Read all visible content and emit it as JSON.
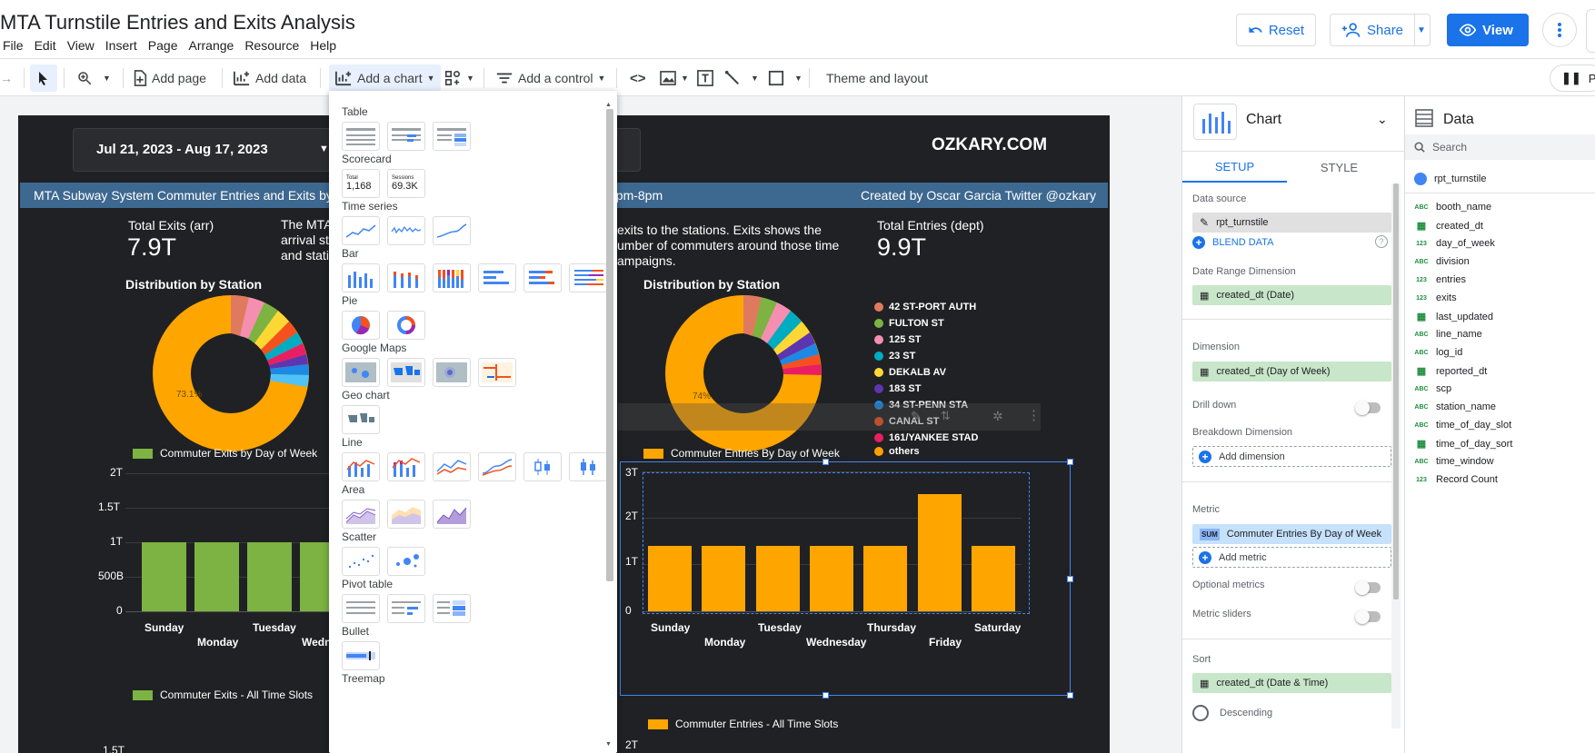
{
  "app": {
    "title": "MTA Turnstile Entries and Exits Analysis",
    "menu": [
      "File",
      "Edit",
      "View",
      "Insert",
      "Page",
      "Arrange",
      "Resource",
      "Help"
    ],
    "buttons": {
      "reset": "Reset",
      "share": "Share",
      "view": "View"
    }
  },
  "toolbar": {
    "add_page": "Add page",
    "add_data": "Add data",
    "add_chart": "Add a chart",
    "add_control": "Add a control",
    "theme_layout": "Theme and layout",
    "page_pill": "Pa"
  },
  "dashboard": {
    "date_range": "Jul 21, 2023 - Aug 17, 2023",
    "brand": "OZKARY.COM",
    "banner_left": "MTA Subway System Commuter Entries and Exits by",
    "banner_mid": "2pm-8pm",
    "banner_right": "Created by Oscar Garcia Twitter @ozkary",
    "left": {
      "kpi_title": "Total Exits (arr)",
      "kpi_value": "7.9T",
      "desc_lines": [
        "The MTA",
        "arrival st",
        "and stati"
      ],
      "dist_title": "Distribution by Station",
      "donut_pct": "73.1%",
      "bar_legend": "Commuter Exits by Day of Week",
      "slots_legend": "Commuter Exits - All Time Slots",
      "y_ticks": [
        "2T",
        "1.5T",
        "1T",
        "500B",
        "0"
      ],
      "bottom_tick": "1.5T",
      "days_top": [
        "Sunday",
        "Tuesday",
        "Wedn"
      ],
      "days_bottom": [
        "Monday"
      ]
    },
    "right": {
      "desc_lines": [
        "exits to the stations. Exits shows the",
        "umber of commuters around those time",
        "ampaigns."
      ],
      "kpi_title": "Total Entries (dept)",
      "kpi_value": "9.9T",
      "dist_title": "Distribution by Station",
      "donut_pct": "74%",
      "stations": [
        {
          "name": "42 ST-PORT AUTH",
          "color": "#e07a5f"
        },
        {
          "name": "FULTON ST",
          "color": "#7cb342"
        },
        {
          "name": "125 ST",
          "color": "#f48fb1"
        },
        {
          "name": "23 ST",
          "color": "#00acc1"
        },
        {
          "name": "DEKALB AV",
          "color": "#fdd835"
        },
        {
          "name": "183 ST",
          "color": "#5e35b1"
        },
        {
          "name": "34 ST-PENN STA",
          "color": "#1e88e5"
        },
        {
          "name": "CANAL ST",
          "color": "#f4511e"
        },
        {
          "name": "161/YANKEE STAD",
          "color": "#e91e63"
        },
        {
          "name": "others",
          "color": "#ffa000"
        }
      ],
      "bar_legend": "Commuter Entries By Day of Week",
      "slots_legend": "Commuter Entries - All Time Slots",
      "y_ticks": [
        "3T",
        "2T",
        "1T",
        "0"
      ],
      "bottom_tick": "2T",
      "days_top": [
        "Sunday",
        "Tuesday",
        "Thursday",
        "Saturday"
      ],
      "days_bottom": [
        "Monday",
        "Wednesday",
        "Friday"
      ]
    },
    "colors": {
      "exits_bar": "#7cb342",
      "entries_bar": "#ffa500",
      "donut_main": "#ffa500",
      "banner": "#3d6890"
    }
  },
  "chart_picker": {
    "sections": [
      "Table",
      "Scorecard",
      "Time series",
      "Bar",
      "Pie",
      "Google Maps",
      "Geo chart",
      "Line",
      "Area",
      "Scatter",
      "Pivot table",
      "Bullet",
      "Treemap"
    ],
    "scorecard_a": {
      "label": "Total",
      "value": "1,168"
    },
    "scorecard_b": {
      "label": "Sessions",
      "value": "69.3K"
    }
  },
  "props": {
    "title": "Chart",
    "tabs": [
      "SETUP",
      "STYLE"
    ],
    "data_source_label": "Data source",
    "data_source": "rpt_turnstile",
    "blend": "BLEND DATA",
    "date_range_label": "Date Range Dimension",
    "date_range_chip": "created_dt (Date)",
    "dimension_label": "Dimension",
    "dimension_chip": "created_dt (Day of Week)",
    "drill_down": "Drill down",
    "breakdown_label": "Breakdown Dimension",
    "add_dimension": "Add dimension",
    "metric_label": "Metric",
    "metric_agg": "SUM",
    "metric_chip": "Commuter Entries By Day of Week",
    "add_metric": "Add metric",
    "optional_metrics": "Optional metrics",
    "metric_sliders": "Metric sliders",
    "sort_label": "Sort",
    "sort_chip": "created_dt (Date & Time)",
    "descending": "Descending"
  },
  "data_panel": {
    "title": "Data",
    "search_placeholder": "Search",
    "source": "rpt_turnstile",
    "fields": [
      {
        "type": "ABC",
        "name": "booth_name"
      },
      {
        "type": "date",
        "name": "created_dt"
      },
      {
        "type": "123",
        "name": "day_of_week"
      },
      {
        "type": "ABC",
        "name": "division"
      },
      {
        "type": "123",
        "name": "entries"
      },
      {
        "type": "123",
        "name": "exits"
      },
      {
        "type": "date",
        "name": "last_updated"
      },
      {
        "type": "ABC",
        "name": "line_name"
      },
      {
        "type": "ABC",
        "name": "log_id"
      },
      {
        "type": "date",
        "name": "reported_dt"
      },
      {
        "type": "ABC",
        "name": "scp"
      },
      {
        "type": "ABC",
        "name": "station_name"
      },
      {
        "type": "ABC",
        "name": "time_of_day_slot"
      },
      {
        "type": "date",
        "name": "time_of_day_sort"
      },
      {
        "type": "ABC",
        "name": "time_window"
      },
      {
        "type": "123",
        "name": "Record Count"
      }
    ]
  }
}
